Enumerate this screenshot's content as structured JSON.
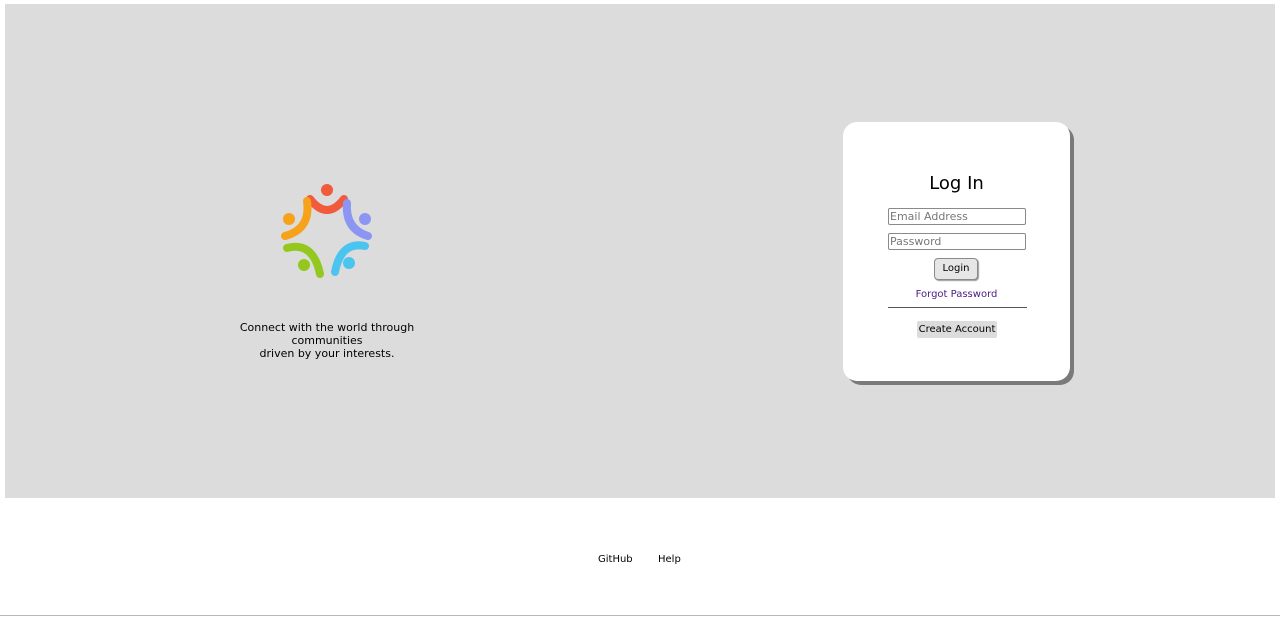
{
  "brand": {
    "logo_icon": "community-people-circle-icon",
    "tagline_line1": "Connect with the world through communities",
    "tagline_line2": "driven by your interests."
  },
  "login_card": {
    "title": "Log In",
    "email_placeholder": "Email Address",
    "email_value": "",
    "password_placeholder": "Password",
    "password_value": "",
    "login_label": "Login",
    "forgot_label": "Forgot Password",
    "create_account_label": "Create Account"
  },
  "footer": {
    "links": [
      "GitHub",
      "Help"
    ]
  },
  "colors": {
    "hero_background": "#dcdcdc",
    "card_background": "#ffffff",
    "link_purple": "#4b1a86",
    "logo_red": "#f15a3a",
    "logo_orange": "#f7a21b",
    "logo_blue": "#8c96f2",
    "logo_green": "#95c81f",
    "logo_cyan": "#4cc4f0"
  }
}
